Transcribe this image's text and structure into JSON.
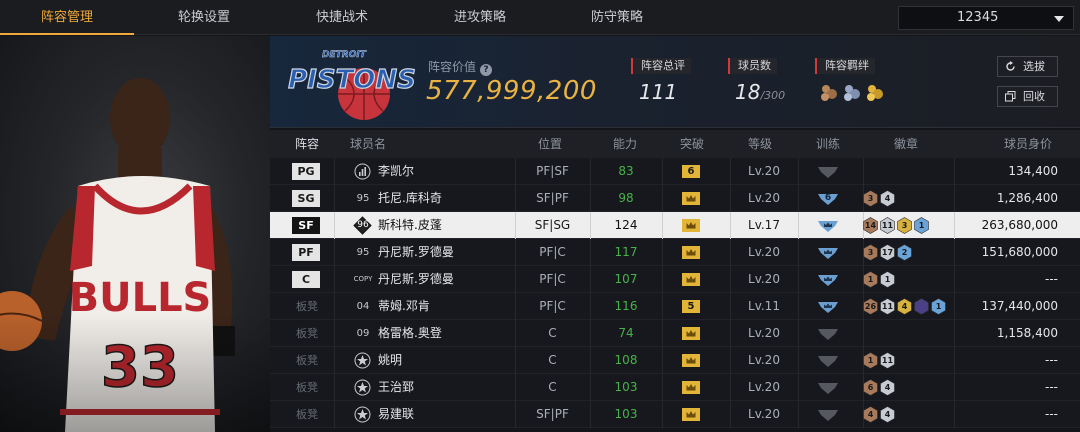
{
  "nav": {
    "tabs": [
      {
        "label": "阵容管理",
        "active": true
      },
      {
        "label": "轮换设置",
        "active": false
      },
      {
        "label": "快捷战术",
        "active": false
      },
      {
        "label": "进攻策略",
        "active": false
      },
      {
        "label": "防守策略",
        "active": false
      }
    ],
    "lineup_selector": {
      "value": "12345"
    }
  },
  "team": {
    "logo_text": "PISTONS",
    "logo_subtext": "DETROIT",
    "value_label": "阵容价值",
    "value": "577,999,200",
    "overall_label": "阵容总评",
    "overall": "111",
    "players_label": "球员数",
    "players_count": "18",
    "players_max": "/300",
    "bond_label": "阵容羁绊",
    "bond_icons": [
      "bond-icon-bronze",
      "bond-icon-silver",
      "bond-icon-gold"
    ],
    "buttons": {
      "select": "选拔",
      "recycle": "回收"
    }
  },
  "table": {
    "headers": [
      "阵容",
      "球员名",
      "位置",
      "能力",
      "突破",
      "等级",
      "训练",
      "徽章",
      "球员身价"
    ],
    "rows": [
      {
        "slot": "PG",
        "slot_type": "starter",
        "jersey": "bars-icon",
        "name": "李凯尔",
        "position": "PF|SF",
        "ability": "83",
        "ability_color": "green",
        "breakthrough": "6",
        "level": "Lv.20",
        "training": "gray",
        "badges": [],
        "value": "134,400",
        "selected": false
      },
      {
        "slot": "SG",
        "slot_type": "starter",
        "jersey": "95",
        "name": "托尼.库科奇",
        "position": "SF|PF",
        "ability": "98",
        "ability_color": "green",
        "breakthrough": "crown",
        "level": "Lv.20",
        "training": "6",
        "badges": [
          {
            "t": "3",
            "c": "bronze"
          },
          {
            "t": "4",
            "c": "silver"
          }
        ],
        "value": "1,286,400",
        "selected": false
      },
      {
        "slot": "SF",
        "slot_type": "starter",
        "jersey": "96",
        "name": "斯科特.皮蓬",
        "position": "SF|SG",
        "ability": "124",
        "ability_color": "white",
        "breakthrough": "crown",
        "level": "Lv.17",
        "training": "crown",
        "badges": [
          {
            "t": "14",
            "c": "bronze"
          },
          {
            "t": "11",
            "c": "silver"
          },
          {
            "t": "3",
            "c": "gold"
          },
          {
            "t": "1",
            "c": "blue"
          }
        ],
        "value": "263,680,000",
        "selected": true
      },
      {
        "slot": "PF",
        "slot_type": "starter",
        "jersey": "95",
        "name": "丹尼斯.罗德曼",
        "position": "PF|C",
        "ability": "117",
        "ability_color": "green",
        "breakthrough": "crown",
        "level": "Lv.20",
        "training": "crown",
        "badges": [
          {
            "t": "3",
            "c": "bronze"
          },
          {
            "t": "17",
            "c": "silver"
          },
          {
            "t": "2",
            "c": "blue"
          }
        ],
        "value": "151,680,000",
        "selected": false
      },
      {
        "slot": "C",
        "slot_type": "starter",
        "jersey": "COPY",
        "name": "丹尼斯.罗德曼",
        "position": "PF|C",
        "ability": "107",
        "ability_color": "green",
        "breakthrough": "crown",
        "level": "Lv.20",
        "training": "crown",
        "badges": [
          {
            "t": "1",
            "c": "bronze"
          },
          {
            "t": "1",
            "c": "silver"
          }
        ],
        "value": "---",
        "selected": false
      },
      {
        "slot": "板凳",
        "slot_type": "bench",
        "jersey": "04",
        "name": "蒂姆.邓肯",
        "position": "PF|C",
        "ability": "116",
        "ability_color": "green",
        "breakthrough": "5",
        "level": "Lv.11",
        "training": "crown",
        "badges": [
          {
            "t": "26",
            "c": "bronze"
          },
          {
            "t": "11",
            "c": "silver"
          },
          {
            "t": "4",
            "c": "gold"
          },
          {
            "t": "",
            "c": "purple"
          },
          {
            "t": "1",
            "c": "blue"
          }
        ],
        "value": "137,440,000",
        "selected": false
      },
      {
        "slot": "板凳",
        "slot_type": "bench",
        "jersey": "09",
        "name": "格雷格.奥登",
        "position": "C",
        "ability": "74",
        "ability_color": "green",
        "breakthrough": "crown",
        "level": "Lv.20",
        "training": "gray",
        "badges": [],
        "value": "1,158,400",
        "selected": false
      },
      {
        "slot": "板凳",
        "slot_type": "bench",
        "jersey": "star",
        "name": "姚明",
        "position": "C",
        "ability": "108",
        "ability_color": "green",
        "breakthrough": "crown",
        "level": "Lv.20",
        "training": "gray",
        "badges": [
          {
            "t": "1",
            "c": "bronze"
          },
          {
            "t": "11",
            "c": "silver"
          }
        ],
        "value": "---",
        "selected": false
      },
      {
        "slot": "板凳",
        "slot_type": "bench",
        "jersey": "star",
        "name": "王治郅",
        "position": "C",
        "ability": "103",
        "ability_color": "green",
        "breakthrough": "crown",
        "level": "Lv.20",
        "training": "gray",
        "badges": [
          {
            "t": "6",
            "c": "bronze"
          },
          {
            "t": "4",
            "c": "silver"
          }
        ],
        "value": "---",
        "selected": false
      },
      {
        "slot": "板凳",
        "slot_type": "bench",
        "jersey": "star",
        "name": "易建联",
        "position": "SF|PF",
        "ability": "103",
        "ability_color": "green",
        "breakthrough": "crown",
        "level": "Lv.20",
        "training": "gray",
        "badges": [
          {
            "t": "4",
            "c": "bronze"
          },
          {
            "t": "4",
            "c": "silver"
          }
        ],
        "value": "---",
        "selected": false
      }
    ]
  },
  "colors": {
    "accent": "#f0a93a",
    "value_gold": "#e9b343",
    "ability_green": "#48b24a",
    "stat_red": "#d23a3a"
  }
}
